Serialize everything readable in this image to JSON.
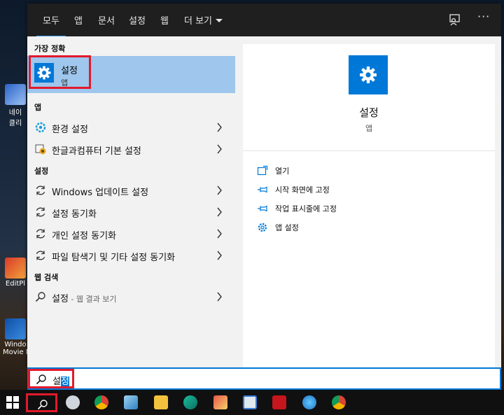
{
  "desktop": {
    "icons": [
      {
        "label": "네이\n클리"
      },
      {
        "label": "EditPl"
      },
      {
        "label": "Windo\nMovie M"
      }
    ]
  },
  "tabs": [
    {
      "label": "모두",
      "active": true
    },
    {
      "label": "앱"
    },
    {
      "label": "문서"
    },
    {
      "label": "설정"
    },
    {
      "label": "웹"
    },
    {
      "label": "더 보기"
    }
  ],
  "left": {
    "best_match_header": "가장 정확",
    "best_match": {
      "name": "설정",
      "type": "앱",
      "icon": "gear-icon"
    },
    "apps_header": "앱",
    "apps": [
      {
        "label": "환경 설정",
        "icon": "settings-shell-icon"
      },
      {
        "label": "한글과컴퓨터 기본 설정",
        "icon": "hancom-icon"
      }
    ],
    "settings_header": "설정",
    "settings": [
      {
        "label": "Windows 업데이트 설정",
        "icon": "sync-icon"
      },
      {
        "label": "설정 동기화",
        "icon": "sync-icon"
      },
      {
        "label": "개인 설정 동기화",
        "icon": "sync-icon"
      },
      {
        "label": "파일 탐색기 및 기타 설정 동기화",
        "icon": "sync-icon"
      }
    ],
    "web_header": "웹 검색",
    "web": {
      "query": "설정",
      "suffix": " - 웹 결과 보기",
      "icon": "search-icon"
    }
  },
  "preview": {
    "name": "설정",
    "type": "앱",
    "actions": [
      {
        "label": "열기",
        "icon": "open-icon"
      },
      {
        "label": "시작 화면에 고정",
        "icon": "pin-icon"
      },
      {
        "label": "작업 표시줄에 고정",
        "icon": "pin-icon"
      },
      {
        "label": "앱 설정",
        "icon": "gear-icon"
      }
    ]
  },
  "search": {
    "typed": "설",
    "selected": "정"
  },
  "colors": {
    "accent": "#0078d7",
    "highlight": "#e2192c",
    "selected_row": "#9fc6ec",
    "tab_bg": "#1f1f1f"
  }
}
